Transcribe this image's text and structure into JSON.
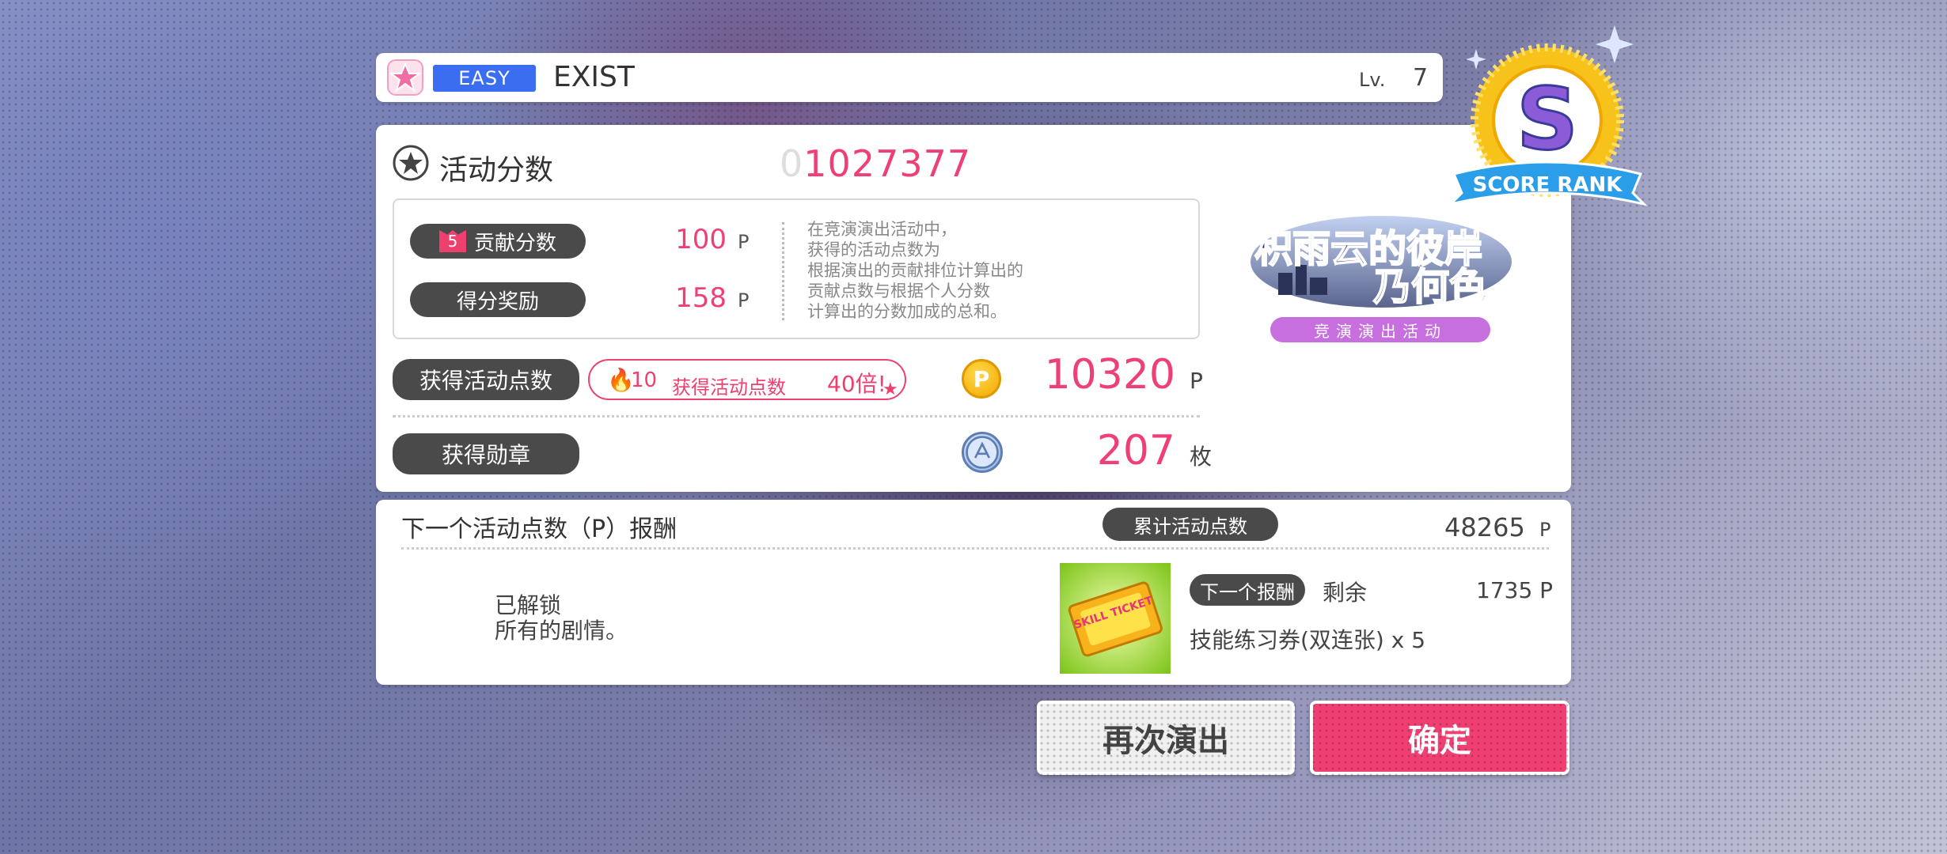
{
  "song": {
    "difficulty": "EASY",
    "title": "EXIST",
    "level_label": "Lv.",
    "level_value": "7"
  },
  "score": {
    "label": "活动分数",
    "leading_zero": "0",
    "value": "1027377"
  },
  "details": {
    "contribution_rank": "5",
    "contribution_label": "贡献分数",
    "contribution_value": "100",
    "bonus_label": "得分奖励",
    "bonus_value": "158",
    "unit_p": "P",
    "description": "在竞演演出活动中，\n获得的活动点数为\n根据演出的贡献排位计算出的\n贡献点数与根据个人分数\n计算出的分数加成的总和。"
  },
  "points": {
    "label": "获得活动点数",
    "boost_value": "10",
    "boost_label": "获得活动点数",
    "boost_multiplier": "40倍!",
    "coin_letter": "P",
    "value": "10320",
    "unit": "P"
  },
  "medal": {
    "label": "获得勋章",
    "value": "207",
    "unit": "枚"
  },
  "event": {
    "logo_line1": "积雨云的彼岸",
    "logo_line2": "乃何色",
    "tag": "竞演演出活动"
  },
  "rank": {
    "letter": "S",
    "banner": "SCORE RANK"
  },
  "reward": {
    "title": "下一个活动点数（P）报酬",
    "total_label": "累计活动点数",
    "total_value": "48265",
    "total_unit": "P",
    "unlock_text": "已解锁\n所有的剧情。",
    "next_label": "下一个报酬",
    "remain_label": "剩余",
    "remain_value": "1735 P",
    "ticket_name": "技能练习券(双连张) x 5",
    "ticket_text": "SKILL TICKET"
  },
  "buttons": {
    "replay": "再次演出",
    "confirm": "确定"
  },
  "colors": {
    "accent_pink": "#ef3f77",
    "difficulty_blue": "#3a6df0",
    "event_purple": "#c86fe0"
  }
}
